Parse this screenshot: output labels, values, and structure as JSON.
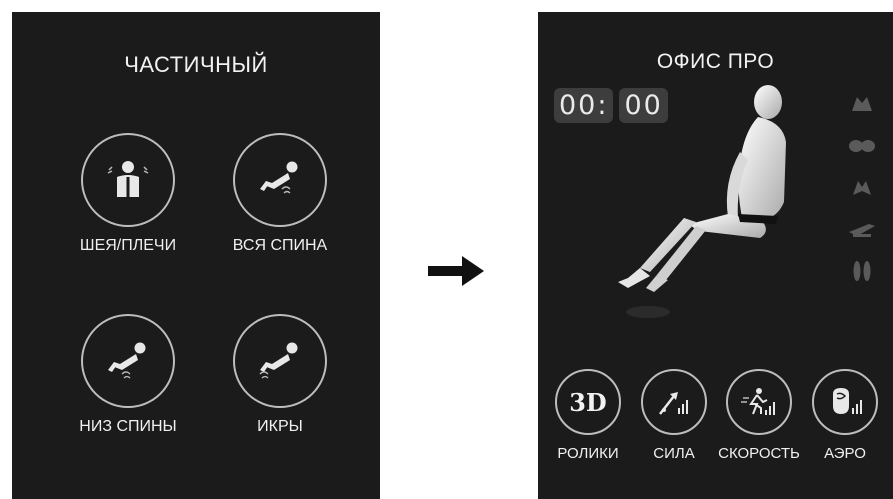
{
  "left_panel": {
    "title": "ЧАСТИЧНЫЙ",
    "modes": [
      {
        "label": "ШЕЯ/ПЛЕЧИ",
        "icon": "neck-shoulder-icon"
      },
      {
        "label": "ВСЯ СПИНА",
        "icon": "full-back-icon"
      },
      {
        "label": "НИЗ СПИНЫ",
        "icon": "lower-back-icon"
      },
      {
        "label": "ИКРЫ",
        "icon": "calves-icon"
      }
    ]
  },
  "right_panel": {
    "title": "ОФИС ПРО",
    "timer": {
      "minutes": "00",
      "separator": ":",
      "seconds": "00"
    },
    "area_icons": [
      "head-area-icon",
      "shoulder-area-icon",
      "back-area-icon",
      "seat-area-icon",
      "feet-area-icon"
    ],
    "controls": [
      {
        "label": "РОЛИКИ",
        "icon_text": "3D"
      },
      {
        "label": "СИЛА",
        "icon": "intensity-icon"
      },
      {
        "label": "СКОРОСТЬ",
        "icon": "speed-icon"
      },
      {
        "label": "АЭРО",
        "icon": "air-icon"
      }
    ]
  },
  "colors": {
    "panel_bg": "#1b1b1b",
    "ring": "#bdbdbd",
    "text": "#f0f0f0",
    "timer_bg": "#3d3d3d",
    "accent": "#ffffff"
  }
}
